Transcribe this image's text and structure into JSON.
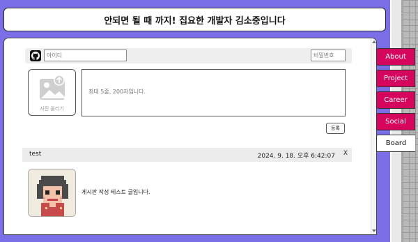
{
  "header": {
    "title": "안되면 될 때 까지! 집요한 개발자 김소중입니다"
  },
  "login": {
    "id_placeholder": "아이디",
    "pw_placeholder": "비밀번호",
    "icon": "github-icon"
  },
  "compose": {
    "photo_label": "사진 올리기",
    "content_placeholder": "최대 5줄, 200자입니다.",
    "submit_label": "등록"
  },
  "post": {
    "author": "test",
    "date": "2024. 9. 18. 오후 6:42:07",
    "delete_label": "X",
    "body": "게시판 작성 테스트 글입니다."
  },
  "nav": {
    "items": [
      {
        "label": "About",
        "active": false
      },
      {
        "label": "Project",
        "active": false
      },
      {
        "label": "Career",
        "active": false
      },
      {
        "label": "Social",
        "active": false
      },
      {
        "label": "Board",
        "active": true
      }
    ]
  },
  "colors": {
    "background": "#7b6fe8",
    "nav_accent": "#d6065f"
  }
}
